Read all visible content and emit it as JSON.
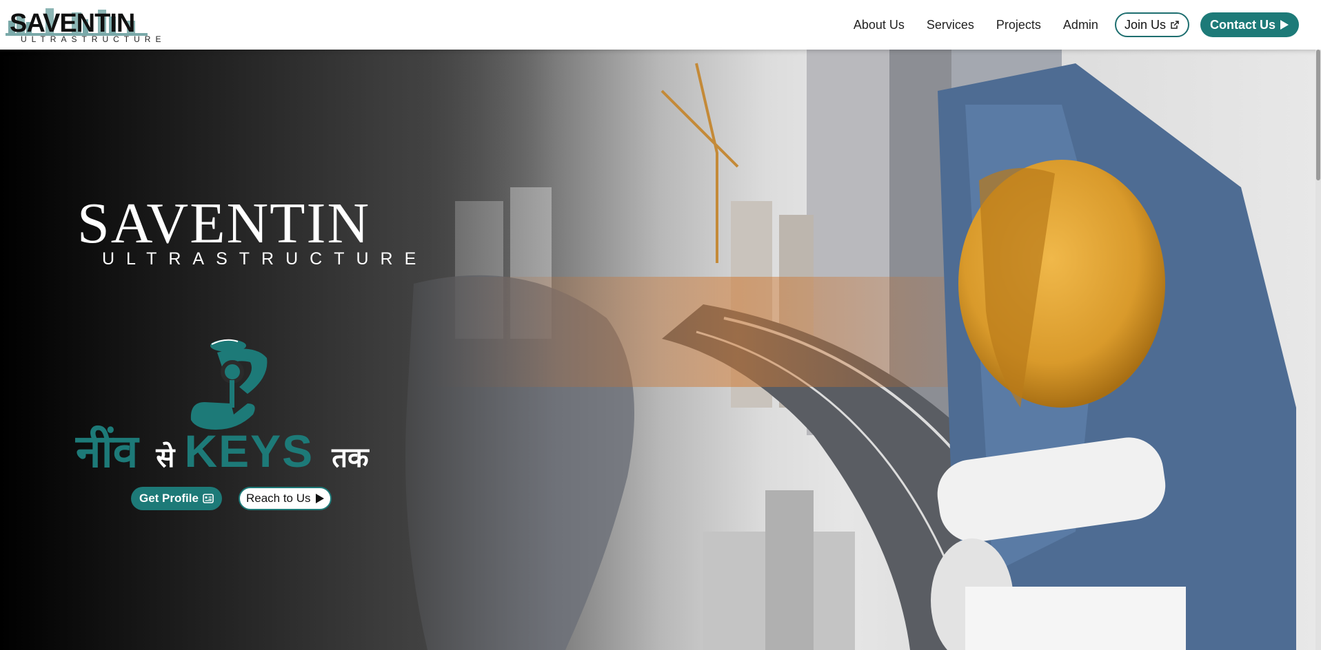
{
  "brand": {
    "name": "SAVENTIN",
    "subtitle": "ULTRASTRUCTURE"
  },
  "nav": {
    "links": [
      "About Us",
      "Services",
      "Projects",
      "Admin"
    ],
    "join_label": "Join Us",
    "contact_label": "Contact Us"
  },
  "hero": {
    "brand_name": "SAVENTIN",
    "brand_subtitle": "ULTRASTRUCTURE",
    "tagline": {
      "part1": "नींव",
      "part2": "से",
      "part3": "KEYS",
      "part4": "तक"
    },
    "profile_button": "Get Profile",
    "reach_button": "Reach to Us"
  },
  "icons": {
    "join": "external-link-icon",
    "contact": "play-arrow-icon",
    "profile": "profile-card-icon",
    "reach": "play-arrow-icon",
    "emblem": "hand-key-emblem-icon"
  },
  "colors": {
    "accent": "#1d7a78",
    "dark": "#111111",
    "white": "#ffffff"
  }
}
